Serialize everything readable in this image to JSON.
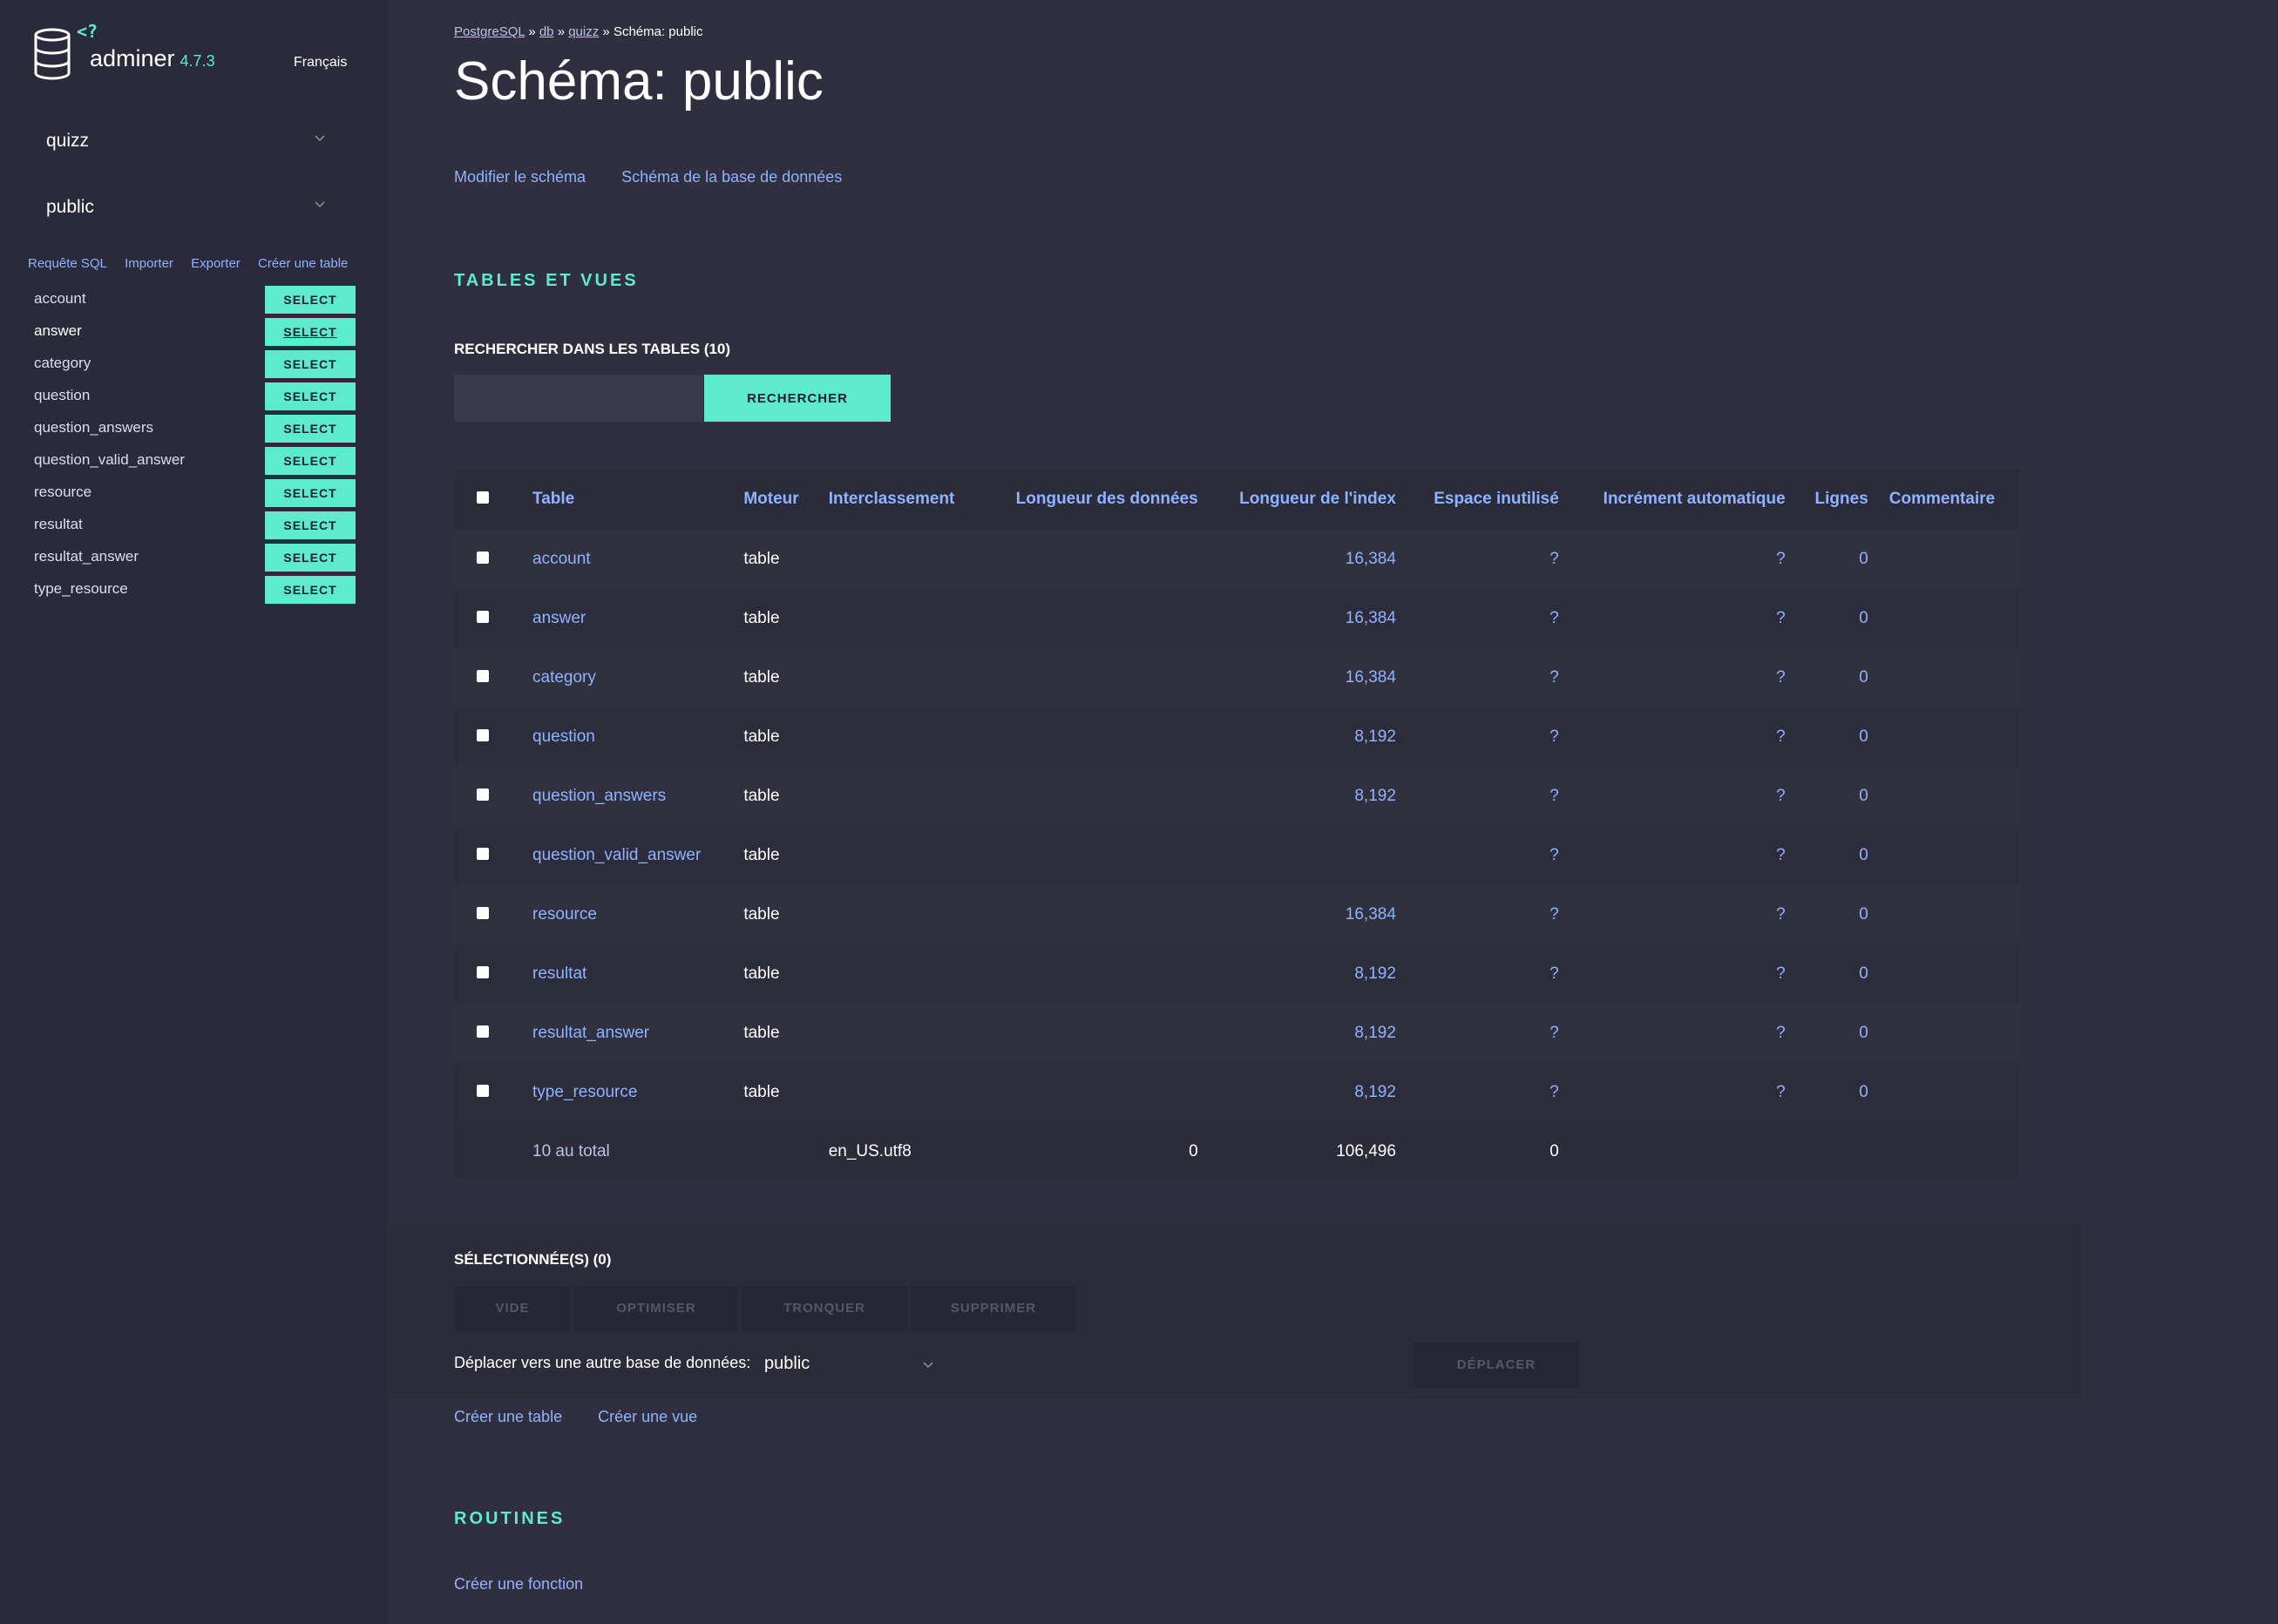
{
  "app": {
    "brand": "adminer",
    "version": "4.7.3",
    "language": "Français"
  },
  "sidebar": {
    "database_select": "quizz",
    "schema_select": "public",
    "links": [
      "Requête SQL",
      "Importer",
      "Exporter",
      "Créer une table"
    ],
    "select_label": "SELECT",
    "active_table": "answer",
    "tables": [
      "account",
      "answer",
      "category",
      "question",
      "question_answers",
      "question_valid_answer",
      "resource",
      "resultat",
      "resultat_answer",
      "type_resource"
    ]
  },
  "breadcrumb": {
    "items": [
      "PostgreSQL",
      "db",
      "quizz"
    ],
    "separator": "»",
    "current": "Schéma: public"
  },
  "page_title": "Schéma: public",
  "schema_links": [
    "Modifier le schéma",
    "Schéma de la base de données"
  ],
  "tables_section": {
    "heading": "TABLES ET VUES",
    "search_label": "RECHERCHER DANS LES TABLES (10)",
    "search_value": "",
    "search_button": "RECHERCHER",
    "columns": [
      "Table",
      "Moteur",
      "Interclassement",
      "Longueur des données",
      "Longueur de l'index",
      "Espace inutilisé",
      "Incrément automatique",
      "Lignes",
      "Commentaire"
    ],
    "rows": [
      {
        "name": "account",
        "engine": "table",
        "collation": "",
        "data_length": "",
        "index_length": "16,384",
        "free": "?",
        "auto_inc": "?",
        "rows": "0",
        "comment": ""
      },
      {
        "name": "answer",
        "engine": "table",
        "collation": "",
        "data_length": "",
        "index_length": "16,384",
        "free": "?",
        "auto_inc": "?",
        "rows": "0",
        "comment": ""
      },
      {
        "name": "category",
        "engine": "table",
        "collation": "",
        "data_length": "",
        "index_length": "16,384",
        "free": "?",
        "auto_inc": "?",
        "rows": "0",
        "comment": ""
      },
      {
        "name": "question",
        "engine": "table",
        "collation": "",
        "data_length": "",
        "index_length": "8,192",
        "free": "?",
        "auto_inc": "?",
        "rows": "0",
        "comment": ""
      },
      {
        "name": "question_answers",
        "engine": "table",
        "collation": "",
        "data_length": "",
        "index_length": "8,192",
        "free": "?",
        "auto_inc": "?",
        "rows": "0",
        "comment": ""
      },
      {
        "name": "question_valid_answer",
        "engine": "table",
        "collation": "",
        "data_length": "",
        "index_length": "",
        "free": "?",
        "auto_inc": "?",
        "rows": "0",
        "comment": ""
      },
      {
        "name": "resource",
        "engine": "table",
        "collation": "",
        "data_length": "",
        "index_length": "16,384",
        "free": "?",
        "auto_inc": "?",
        "rows": "0",
        "comment": ""
      },
      {
        "name": "resultat",
        "engine": "table",
        "collation": "",
        "data_length": "",
        "index_length": "8,192",
        "free": "?",
        "auto_inc": "?",
        "rows": "0",
        "comment": ""
      },
      {
        "name": "resultat_answer",
        "engine": "table",
        "collation": "",
        "data_length": "",
        "index_length": "8,192",
        "free": "?",
        "auto_inc": "?",
        "rows": "0",
        "comment": ""
      },
      {
        "name": "type_resource",
        "engine": "table",
        "collation": "",
        "data_length": "",
        "index_length": "8,192",
        "free": "?",
        "auto_inc": "?",
        "rows": "0",
        "comment": ""
      }
    ],
    "footer": {
      "total": "10 au total",
      "collation": "en_US.utf8",
      "data_length": "0",
      "index_length": "106,496",
      "free": "0"
    }
  },
  "selected_section": {
    "label": "SÉLECTIONNÉE(S) (0)",
    "buttons": [
      "VIDE",
      "OPTIMISER",
      "TRONQUER",
      "SUPPRIMER"
    ],
    "move_label": "Déplacer vers une autre base de données:",
    "move_target": "public",
    "move_button": "DÉPLACER"
  },
  "create_links": [
    "Créer une table",
    "Créer une vue"
  ],
  "routines_section": {
    "heading": "ROUTINES",
    "create_function": "Créer une fonction"
  },
  "colors": {
    "accent": "#5ceccd",
    "link": "#8fb3ff",
    "background": "#2f2f40",
    "sidebar": "#2a2a3a"
  }
}
